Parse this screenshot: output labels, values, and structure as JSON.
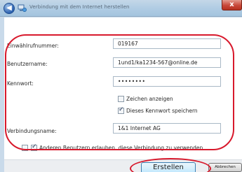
{
  "window": {
    "title": "Verbindung mit dem Internet herstellen"
  },
  "form": {
    "dialup_label": "Einwählrufnummer:",
    "dialup_value": "019167",
    "username_label": "Benutzername:",
    "username_value": "1und1/ka1234-567@online.de",
    "password_label": "Kennwort:",
    "password_value": "••••••••",
    "show_chars_label": "Zeichen anzeigen",
    "show_chars_checked": false,
    "save_password_label": "Dieses Kennwort speichern",
    "save_password_checked": true,
    "connection_name_label": "Verbindungsname:",
    "connection_name_value": "1&1 Internet AG",
    "allow_others_label": "Anderen Benutzern erlauben, diese Verbindung zu verwenden",
    "allow_others_checked": true
  },
  "buttons": {
    "create": "Erstellen",
    "cancel": "Abbrechen"
  },
  "annotation_color": "#d8192c"
}
